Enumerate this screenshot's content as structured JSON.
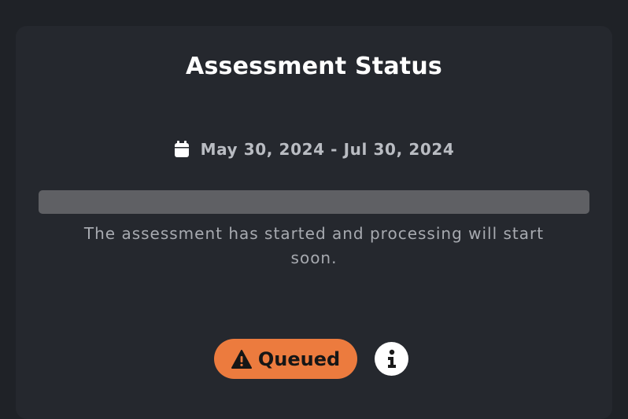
{
  "card": {
    "title": "Assessment Status",
    "date_range": "May 30, 2024 - Jul 30, 2024",
    "date_icon": "calendar-icon",
    "progress": {
      "percent": 0
    },
    "message": "The assessment has started and processing will start soon.",
    "status": {
      "label": "Queued",
      "icon": "warning-icon",
      "color": "#ec7b3e"
    },
    "info_icon": "info-icon"
  },
  "colors": {
    "background": "#1f2227",
    "card": "#25282e",
    "progress_track": "#5f6064",
    "status_queued": "#ec7b3e"
  }
}
